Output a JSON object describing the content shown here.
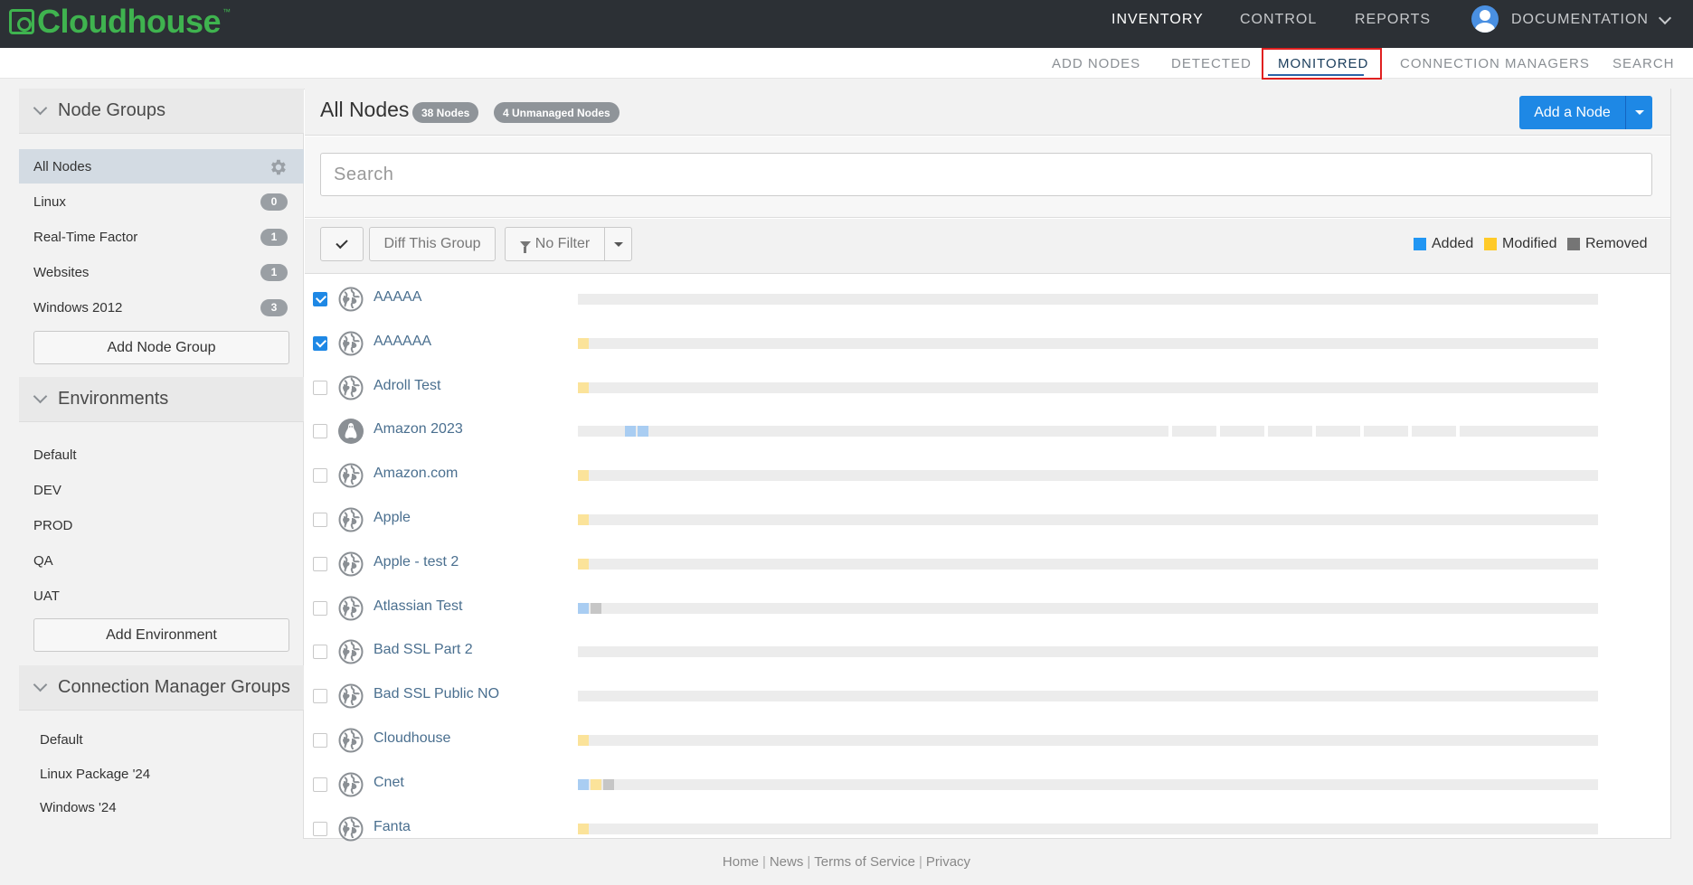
{
  "app": {
    "logo_text": "Cloudhouse",
    "logo_tm": "™"
  },
  "topnav": {
    "inventory": "INVENTORY",
    "control": "CONTROL",
    "reports": "REPORTS",
    "documentation": "DOCUMENTATION"
  },
  "subnav": {
    "add_nodes": "ADD NODES",
    "detected": "DETECTED",
    "monitored": "MONITORED",
    "connection_managers": "CONNECTION MANAGERS",
    "search": "SEARCH"
  },
  "sidebar": {
    "node_groups": {
      "title": "Node Groups",
      "items": [
        {
          "label": "All Nodes",
          "count": ""
        },
        {
          "label": "Linux",
          "count": "0"
        },
        {
          "label": "Real-Time Factor",
          "count": "1"
        },
        {
          "label": "Websites",
          "count": "1"
        },
        {
          "label": "Windows 2012",
          "count": "3"
        }
      ],
      "add_button": "Add Node Group"
    },
    "environments": {
      "title": "Environments",
      "items": [
        "Default",
        "DEV",
        "PROD",
        "QA",
        "UAT"
      ],
      "add_button": "Add Environment"
    },
    "connection_manager_groups": {
      "title": "Connection Manager Groups",
      "items": [
        "Default",
        "Linux Package '24",
        "Windows '24"
      ]
    }
  },
  "main": {
    "title": "All Nodes",
    "nodes_pill": "38 Nodes",
    "unmanaged_pill": "4 Unmanaged Nodes",
    "add_node_button": "Add a Node",
    "search_placeholder": "Search",
    "diff_button": "Diff This Group",
    "filter_button": "No Filter",
    "legend": {
      "added": "Added",
      "modified": "Modified",
      "removed": "Removed"
    }
  },
  "colors": {
    "added": "#2196f3",
    "modified": "#ffca28",
    "removed": "#757575",
    "accent": "#1e88e5",
    "brand": "#3fb34f"
  },
  "nodes": [
    {
      "name": "AAAAA",
      "checked": true,
      "icon": "globe-icon",
      "segments": []
    },
    {
      "name": "AAAAAA",
      "checked": true,
      "icon": "globe-icon",
      "segments": [
        "modified"
      ]
    },
    {
      "name": "Adroll Test",
      "checked": false,
      "icon": "globe-icon",
      "segments": [
        "modified"
      ]
    },
    {
      "name": "Amazon 2023",
      "checked": false,
      "icon": "linux-icon",
      "segments": [
        "added",
        "added"
      ]
    },
    {
      "name": "Amazon.com",
      "checked": false,
      "icon": "globe-icon",
      "segments": [
        "modified"
      ]
    },
    {
      "name": "Apple",
      "checked": false,
      "icon": "globe-icon",
      "segments": [
        "modified"
      ]
    },
    {
      "name": "Apple - test 2",
      "checked": false,
      "icon": "globe-icon",
      "segments": [
        "modified"
      ]
    },
    {
      "name": "Atlassian Test",
      "checked": false,
      "icon": "globe-icon",
      "segments": [
        "added",
        "removed"
      ]
    },
    {
      "name": "Bad SSL Part 2",
      "checked": false,
      "icon": "globe-icon",
      "segments": []
    },
    {
      "name": "Bad SSL Public NO",
      "checked": false,
      "icon": "globe-icon",
      "segments": []
    },
    {
      "name": "Cloudhouse",
      "checked": false,
      "icon": "globe-icon",
      "segments": [
        "modified"
      ]
    },
    {
      "name": "Cnet",
      "checked": false,
      "icon": "globe-icon",
      "segments": [
        "added",
        "modified",
        "removed"
      ]
    },
    {
      "name": "Fanta",
      "checked": false,
      "icon": "globe-icon",
      "segments": [
        "modified"
      ]
    }
  ],
  "footer": {
    "home": "Home",
    "news": "News",
    "terms": "Terms of Service",
    "privacy": "Privacy"
  }
}
